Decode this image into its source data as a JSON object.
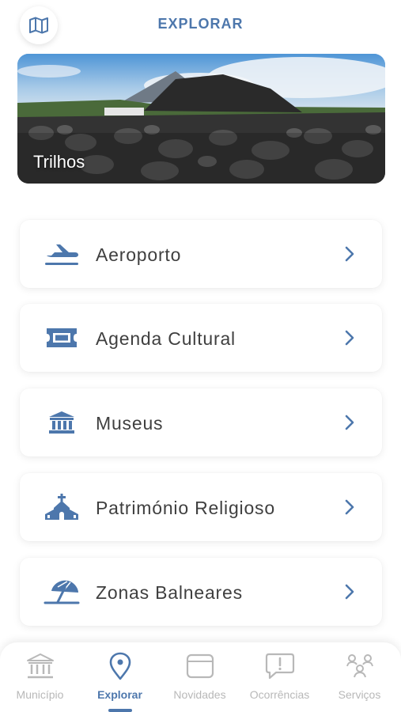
{
  "header": {
    "title": "EXPLORAR",
    "map_button_icon": "map-icon"
  },
  "hero": {
    "label": "Trilhos"
  },
  "menu": {
    "items": [
      {
        "label": "Aeroporto",
        "icon": "airplane-icon"
      },
      {
        "label": "Agenda Cultural",
        "icon": "ticket-icon"
      },
      {
        "label": "Museus",
        "icon": "museum-icon"
      },
      {
        "label": "Património Religioso",
        "icon": "church-icon"
      },
      {
        "label": "Zonas Balneares",
        "icon": "beach-umbrella-icon"
      }
    ]
  },
  "tabbar": {
    "tabs": [
      {
        "label": "Município",
        "icon": "town-hall-icon",
        "active": false
      },
      {
        "label": "Explorar",
        "icon": "location-pin-icon",
        "active": true
      },
      {
        "label": "Novidades",
        "icon": "card-icon",
        "active": false
      },
      {
        "label": "Ocorrências",
        "icon": "alert-bubble-icon",
        "active": false
      },
      {
        "label": "Serviços",
        "icon": "services-icon",
        "active": false
      }
    ]
  },
  "colors": {
    "accent": "#4d77ac",
    "inactive": "#b8b8b8",
    "text": "#3f3f3f"
  }
}
